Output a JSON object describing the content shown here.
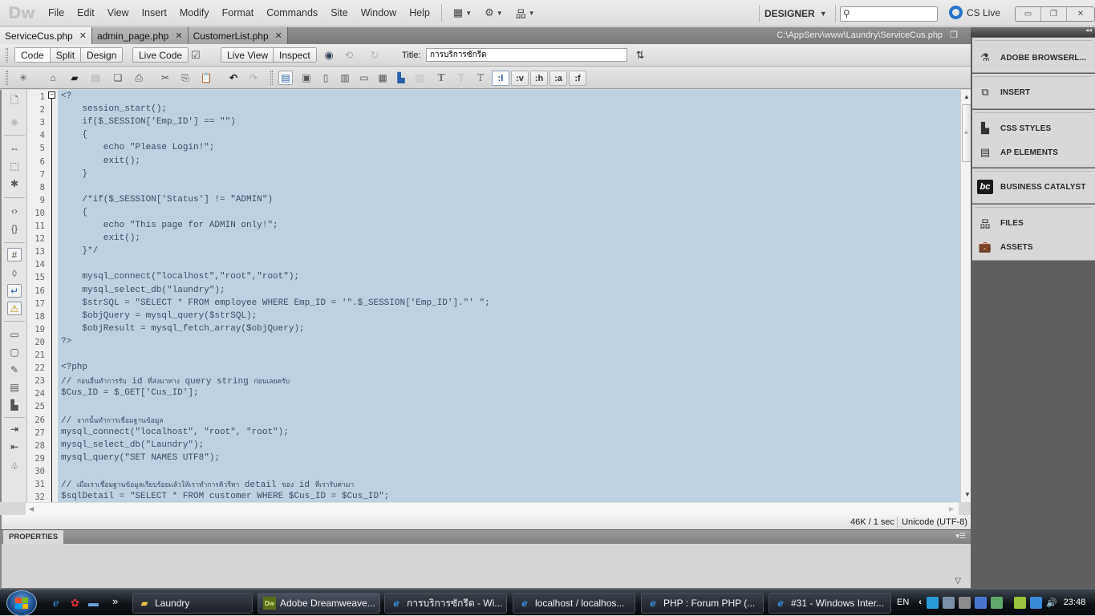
{
  "app": {
    "logo": "Dw",
    "menu": [
      "File",
      "Edit",
      "View",
      "Insert",
      "Modify",
      "Format",
      "Commands",
      "Site",
      "Window",
      "Help"
    ],
    "workspace": "DESIGNER",
    "search_placeholder": "",
    "cs_live": "CS Live"
  },
  "doc_tabs": [
    {
      "label": "ServiceCus.php",
      "active": true
    },
    {
      "label": "admin_page.php",
      "active": false
    },
    {
      "label": "CustomerList.php",
      "active": false
    }
  ],
  "file_path": "C:\\AppServ\\www\\Laundry\\ServiceCus.php",
  "doc_toolbar": {
    "view_buttons": [
      "Code",
      "Split",
      "Design"
    ],
    "active_view": "Code",
    "live_code": "Live Code",
    "live_view": "Live View",
    "inspect": "Inspect",
    "title_label": "Title:",
    "title_value": "การบริการซักรีด"
  },
  "coding_toolbar": {
    "selector_buttons": [
      ":l",
      ":v",
      ":h",
      ":a",
      ":f"
    ],
    "active_selector": ":l"
  },
  "code_lines": [
    "<?",
    "    session_start();",
    "    if($_SESSION['Emp_ID'] == \"\")",
    "    {",
    "        echo \"Please Login!\";",
    "        exit();",
    "    }",
    "",
    "    /*if($_SESSION['Status'] != \"ADMIN\")",
    "    {",
    "        echo \"This page for ADMIN only!\";",
    "        exit();",
    "    }*/",
    "",
    "    mysql_connect(\"localhost\",\"root\",\"root\");",
    "    mysql_select_db(\"laundry\");",
    "    $strSQL = \"SELECT * FROM employee WHERE Emp_ID = '\".$_SESSION['Emp_ID'].\"' \";",
    "    $objQuery = mysql_query($strSQL);",
    "    $objResult = mysql_fetch_array($objQuery);",
    "?>",
    "",
    "<?php",
    "// ก่อนอื่นทำการรับ id ที่ส่งมาทาง query string ก่อนเลยครับ",
    "$Cus_ID = $_GET['Cus_ID'];",
    "",
    "// จากนั้นทำการเชื่อมฐานข้อมูล",
    "mysql_connect(\"localhost\", \"root\", \"root\");",
    "mysql_select_db(\"Laundry\");",
    "mysql_query(\"SET NAMES UTF8\");",
    "",
    "// เมื่อเราเชื่อมฐานข้อมูลเรียบร้อยแล้วให้เราทำการคิวรีหา detail ของ id ที่เรารับค่ามา",
    "$sqlDetail = \"SELECT * FROM customer WHERE $Cus_ID = $Cus_ID\";"
  ],
  "status": {
    "size_time": "46K / 1 sec",
    "encoding": "Unicode (UTF-8)"
  },
  "properties": {
    "tab": "PROPERTIES"
  },
  "dock_panels": [
    {
      "label": "ADOBE BROWSERL...",
      "icon": "browserlab-icon"
    },
    {
      "label": "INSERT",
      "icon": "insert-icon"
    },
    {
      "label": "CSS STYLES",
      "icon": "css-styles-icon"
    },
    {
      "label": "AP ELEMENTS",
      "icon": "ap-elements-icon"
    },
    {
      "label": "BUSINESS CATALYST",
      "icon": "business-catalyst-icon"
    },
    {
      "label": "FILES",
      "icon": "files-icon"
    },
    {
      "label": "ASSETS",
      "icon": "assets-icon"
    }
  ],
  "taskbar": {
    "quick_launch_more": "»",
    "tasks": [
      {
        "label": "Laundry",
        "icon": "folder-icon"
      },
      {
        "label": "Adobe Dreamweave...",
        "icon": "dreamweaver-icon"
      },
      {
        "label": "การบริการซักรีด - Wi...",
        "icon": "ie-icon"
      },
      {
        "label": "localhost / localhos...",
        "icon": "ie-icon"
      },
      {
        "label": "PHP : Forum PHP (...",
        "icon": "ie-icon"
      },
      {
        "label": "#31 - Windows Inter...",
        "icon": "ie-icon"
      }
    ],
    "language": "EN",
    "clock": "23:48"
  },
  "colors": {
    "code_bg": "#bfd1e1",
    "code_text": "#3c4e64",
    "dock_bg": "#5f5f5f",
    "cs_live_accent": "#2a72c9"
  }
}
